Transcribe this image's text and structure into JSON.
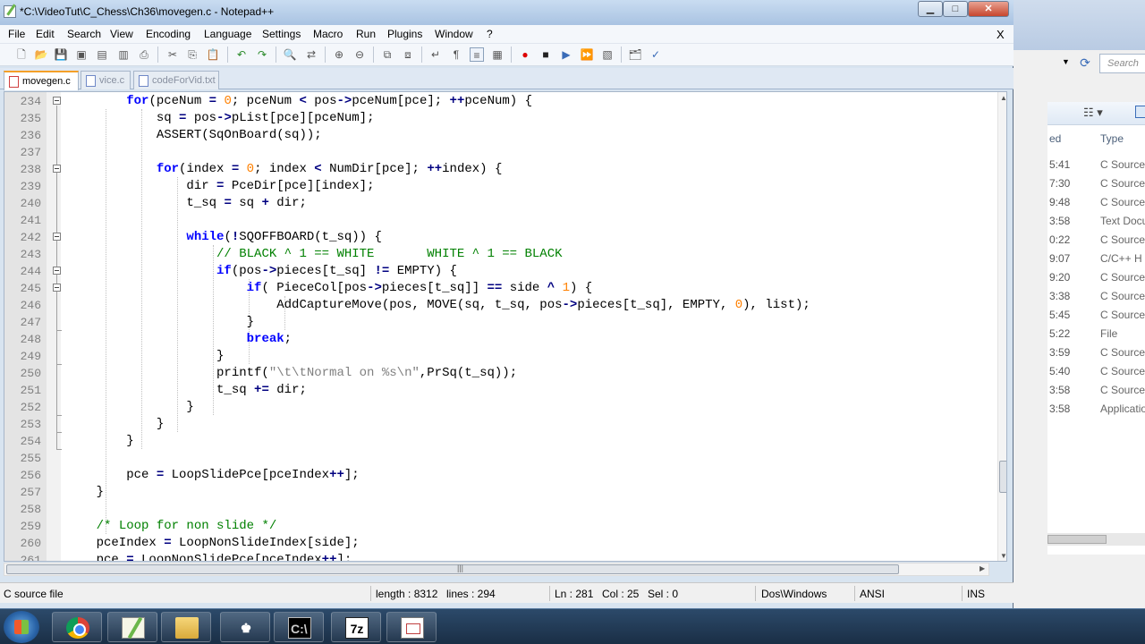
{
  "window": {
    "title": "*C:\\VideoTut\\C_Chess\\Ch36\\movegen.c - Notepad++",
    "min_label": "▁",
    "max_label": "□",
    "close_label": "✕"
  },
  "menu": {
    "items": [
      "File",
      "Edit",
      "Search",
      "View",
      "Encoding",
      "Language",
      "Settings",
      "Macro",
      "Run",
      "Plugins",
      "Window",
      "?"
    ],
    "close_label": "X"
  },
  "tabs": [
    {
      "label": "movegen.c",
      "active": true
    },
    {
      "label": "vice.c",
      "active": false
    },
    {
      "label": "codeForVid.txt",
      "active": false
    }
  ],
  "editor": {
    "lines": [
      {
        "n": "234",
        "html": "        <span class='kw'>for</span>(pceNum <span class='op'>=</span> <span class='num'>0</span>; pceNum <span class='op'>&lt;</span> pos<span class='op'>-&gt;</span>pceNum[pce]; <span class='op'>++</span>pceNum) {"
      },
      {
        "n": "235",
        "html": "            sq <span class='op'>=</span> pos<span class='op'>-&gt;</span>pList[pce][pceNum];"
      },
      {
        "n": "236",
        "html": "            ASSERT(SqOnBoard(sq));"
      },
      {
        "n": "237",
        "html": ""
      },
      {
        "n": "238",
        "html": "            <span class='kw'>for</span>(index <span class='op'>=</span> <span class='num'>0</span>; index <span class='op'>&lt;</span> NumDir[pce]; <span class='op'>++</span>index) {"
      },
      {
        "n": "239",
        "html": "                dir <span class='op'>=</span> PceDir[pce][index];"
      },
      {
        "n": "240",
        "html": "                t_sq <span class='op'>=</span> sq <span class='op'>+</span> dir;"
      },
      {
        "n": "241",
        "html": ""
      },
      {
        "n": "242",
        "html": "                <span class='kw'>while</span>(<span class='op'>!</span>SQOFFBOARD(t_sq)) {"
      },
      {
        "n": "243",
        "html": "                    <span class='cmt'>// BLACK ^ 1 == WHITE       WHITE ^ 1 == BLACK</span>"
      },
      {
        "n": "244",
        "html": "                    <span class='kw'>if</span>(pos<span class='op'>-&gt;</span>pieces[t_sq] <span class='op'>!=</span> EMPTY) {"
      },
      {
        "n": "245",
        "html": "                        <span class='kw'>if</span>( PieceCol[pos<span class='op'>-&gt;</span>pieces[t_sq]] <span class='op'>==</span> side <span class='op'>^</span> <span class='num'>1</span>) {"
      },
      {
        "n": "246",
        "html": "                            AddCaptureMove(pos, MOVE(sq, t_sq, pos<span class='op'>-&gt;</span>pieces[t_sq], EMPTY, <span class='num'>0</span>), list);"
      },
      {
        "n": "247",
        "html": "                        }"
      },
      {
        "n": "248",
        "html": "                        <span class='kw'>break</span>;"
      },
      {
        "n": "249",
        "html": "                    }"
      },
      {
        "n": "250",
        "html": "                    printf(<span class='str'>\"\\t\\tNormal on %s\\n\"</span>,PrSq(t_sq));"
      },
      {
        "n": "251",
        "html": "                    t_sq <span class='op'>+=</span> dir;"
      },
      {
        "n": "252",
        "html": "                }"
      },
      {
        "n": "253",
        "html": "            }"
      },
      {
        "n": "254",
        "html": "        }"
      },
      {
        "n": "255",
        "html": ""
      },
      {
        "n": "256",
        "html": "        pce <span class='op'>=</span> LoopSlidePce[pceIndex<span class='op'>++</span>];"
      },
      {
        "n": "257",
        "html": "    }"
      },
      {
        "n": "258",
        "html": ""
      },
      {
        "n": "259",
        "html": "    <span class='cmt'>/* Loop for non slide */</span>"
      },
      {
        "n": "260",
        "html": "    pceIndex <span class='op'>=</span> LoopNonSlideIndex[side];"
      },
      {
        "n": "261",
        "html": "    pce <span class='op'>=</span> LoopNonSlidePce[pceIndex<span class='op'>++</span>];"
      }
    ]
  },
  "status": {
    "file_type": "C source file",
    "length": "length : 8312",
    "lines": "lines : 294",
    "ln": "Ln : 281",
    "col": "Col : 25",
    "sel": "Sel : 0",
    "eol": "Dos\\Windows",
    "encoding": "ANSI",
    "mode": "INS"
  },
  "background_explorer": {
    "search_placeholder": "Search",
    "column_date": "ed",
    "column_type": "Type",
    "rows": [
      {
        "time": "5:41",
        "type": "C Source"
      },
      {
        "time": "7:30",
        "type": "C Source"
      },
      {
        "time": "9:48",
        "type": "C Source"
      },
      {
        "time": "3:58",
        "type": "Text Docu"
      },
      {
        "time": "0:22",
        "type": "C Source"
      },
      {
        "time": "9:07",
        "type": "C/C++ H"
      },
      {
        "time": "9:20",
        "type": "C Source"
      },
      {
        "time": "3:38",
        "type": "C Source"
      },
      {
        "time": "5:45",
        "type": "C Source"
      },
      {
        "time": "5:22",
        "type": "File"
      },
      {
        "time": "3:59",
        "type": "C Source"
      },
      {
        "time": "5:40",
        "type": "C Source"
      },
      {
        "time": "3:58",
        "type": "C Source"
      },
      {
        "time": "3:58",
        "type": "Applicatio"
      }
    ]
  },
  "taskbar": {
    "items": [
      "chrome-icon",
      "notepadpp-icon",
      "explorer-icon",
      "chess-icon",
      "cmd-icon",
      "7zip-icon",
      "document-icon"
    ],
    "zip_label": "7z",
    "chess_label": "♚",
    "cmd_label": "C:\\"
  }
}
